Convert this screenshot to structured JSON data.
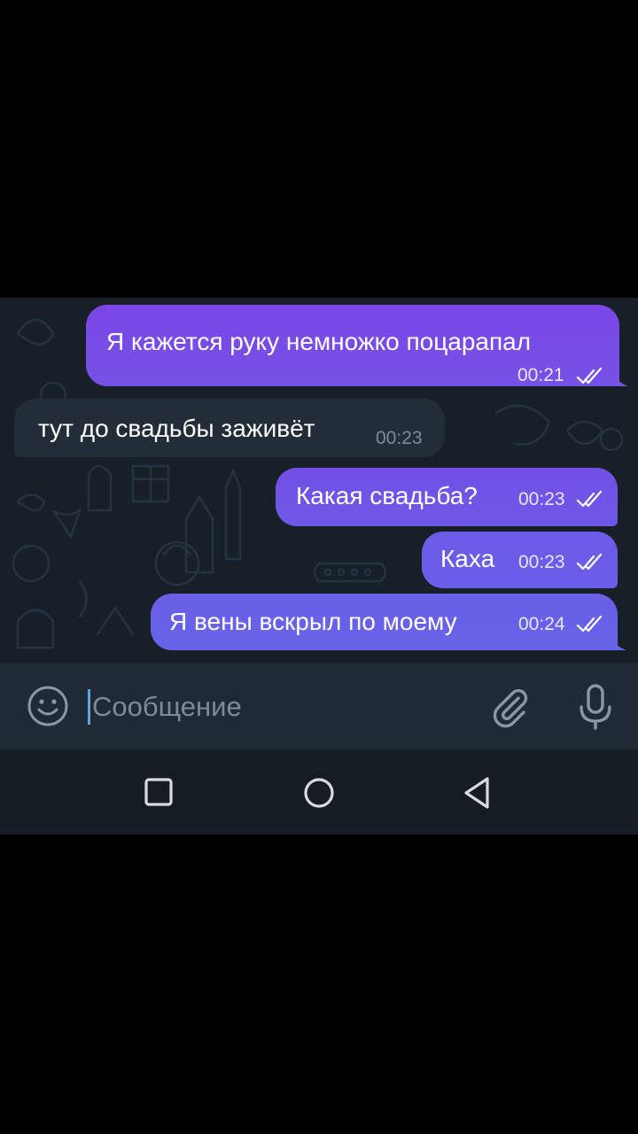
{
  "colors": {
    "chat_background": "#172029",
    "incoming_bubble": "#222d38",
    "outgoing_bubble_top": "#7b45e6",
    "outgoing_bubble_bottom": "#6a5ee8",
    "input_bar": "#1f2a35",
    "nav_bar": "#161c23"
  },
  "messages": [
    {
      "text": "Я кажется руку немножко поцарапал",
      "time": "00:21",
      "direction": "outgoing",
      "status": "read"
    },
    {
      "text": "тут до свадьбы заживёт",
      "time": "00:23",
      "direction": "incoming"
    },
    {
      "text": "Какая свадьба?",
      "time": "00:23",
      "direction": "outgoing",
      "status": "read"
    },
    {
      "text": "Каха",
      "time": "00:23",
      "direction": "outgoing",
      "status": "read"
    },
    {
      "text": "Я вены вскрыл по моему",
      "time": "00:24",
      "direction": "outgoing",
      "status": "read"
    }
  ],
  "composer": {
    "placeholder": "Сообщение",
    "emoji_icon": "smile-icon",
    "attach_icon": "paperclip-icon",
    "voice_icon": "microphone-icon"
  },
  "navigation": {
    "recents_icon": "square-icon",
    "home_icon": "circle-icon",
    "back_icon": "triangle-back-icon"
  }
}
